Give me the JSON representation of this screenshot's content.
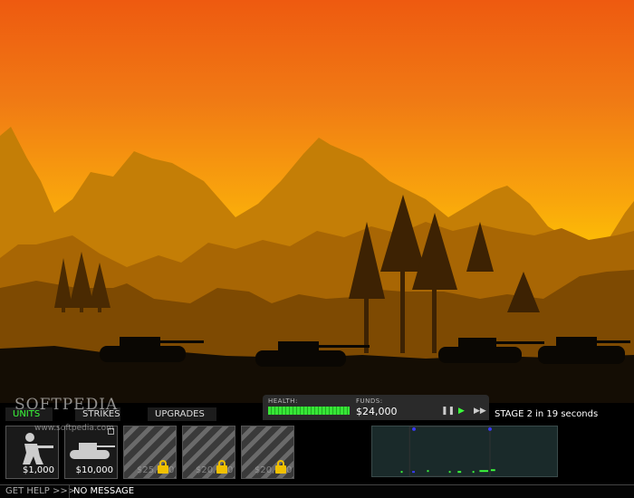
{
  "tabs": [
    {
      "label": "UNITS",
      "active": true
    },
    {
      "label": "STRIKES",
      "active": false
    },
    {
      "label": "UPGRADES",
      "active": false
    }
  ],
  "unit_slots": [
    {
      "icon": "soldier-icon",
      "price": "$1,000",
      "locked": false
    },
    {
      "icon": "tank-icon",
      "price": "$10,000",
      "locked": false
    },
    {
      "icon": "lock-icon",
      "price": "$25,000",
      "locked": true
    },
    {
      "icon": "lock-icon",
      "price": "$20,000",
      "locked": true
    },
    {
      "icon": "lock-icon",
      "price": "$20,000",
      "locked": true
    }
  ],
  "status": {
    "health_label": "HEALTH:",
    "health_fraction": 1.0,
    "funds_label": "FUNDS:",
    "funds_value": "$24,000"
  },
  "controls": {
    "pause": "pause-icon",
    "play": "play-icon",
    "fast_forward": "fast-forward-icon"
  },
  "stage_text": "STAGE 2 in 19 seconds",
  "bottom_bar": {
    "help_label": "GET HELP >>>",
    "message": "NO MESSAGE"
  },
  "watermark": {
    "logo": "SOFTPEDIA",
    "url": "www.softpedia.com"
  },
  "colors": {
    "sky_top": "#ee5a10",
    "sky_bottom": "#ffd000",
    "active_tab": "#3cff3c",
    "health": "#37e637",
    "lock": "#f0c000"
  }
}
